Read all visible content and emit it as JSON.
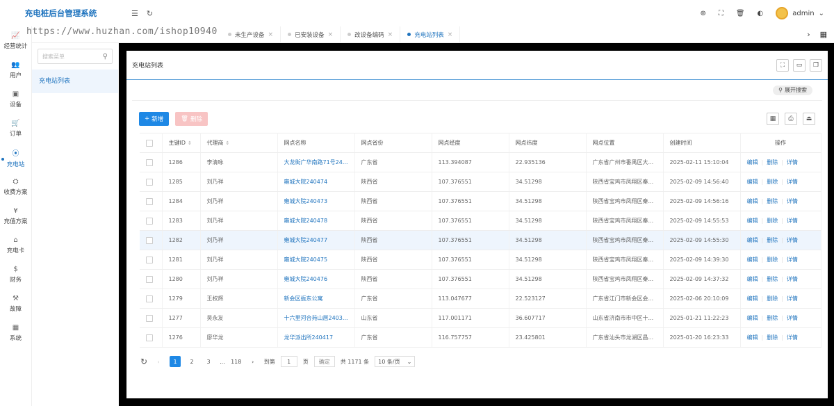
{
  "header": {
    "brand": "充电桩后台管理系统",
    "user": "admin"
  },
  "watermark": "https://www.huzhan.com/ishop10940",
  "tabs": [
    {
      "label": "未生产设备"
    },
    {
      "label": "已安装设备"
    },
    {
      "label": "改设备编码"
    },
    {
      "label": "充电站列表"
    }
  ],
  "nav": [
    {
      "label": "经营统计",
      "icon": "chart-icon"
    },
    {
      "label": "用户",
      "icon": "users-icon"
    },
    {
      "label": "设备",
      "icon": "device-icon"
    },
    {
      "label": "订单",
      "icon": "cart-icon"
    },
    {
      "label": "充电站",
      "icon": "location-icon"
    },
    {
      "label": "收费方案",
      "icon": "plan-icon"
    },
    {
      "label": "充值方案",
      "icon": "yen-icon"
    },
    {
      "label": "充电卡",
      "icon": "tag-icon"
    },
    {
      "label": "财务",
      "icon": "dollar-icon"
    },
    {
      "label": "故障",
      "icon": "wrench-icon"
    },
    {
      "label": "系统",
      "icon": "grid-icon"
    }
  ],
  "submenu": {
    "search_placeholder": "搜索菜单",
    "item": "充电站列表"
  },
  "card": {
    "title": "充电站列表",
    "expand": "展开搜索",
    "add": "新增",
    "delete": "删除"
  },
  "columns": [
    "主键ID",
    "代理商",
    "网点名称",
    "网点省份",
    "网点经度",
    "网点纬度",
    "网点位置",
    "创建时间",
    "操作"
  ],
  "rows": [
    {
      "id": "1286",
      "agent": "李清咏",
      "name": "大龙街广华南路71号24...",
      "province": "广东省",
      "lng": "113.394087",
      "lat": "22.935136",
      "addr": "广东省广州市番禺区大...",
      "time": "2025-02-11 15:10:04"
    },
    {
      "id": "1285",
      "agent": "刘乃祥",
      "name": "雍城大院240474",
      "province": "陕西省",
      "lng": "107.376551",
      "lat": "34.51298",
      "addr": "陕西省宝鸡市凤翔区秦...",
      "time": "2025-02-09 14:56:40"
    },
    {
      "id": "1284",
      "agent": "刘乃祥",
      "name": "雍城大院240473",
      "province": "陕西省",
      "lng": "107.376551",
      "lat": "34.51298",
      "addr": "陕西省宝鸡市凤翔区秦...",
      "time": "2025-02-09 14:56:16"
    },
    {
      "id": "1283",
      "agent": "刘乃祥",
      "name": "雍城大院240478",
      "province": "陕西省",
      "lng": "107.376551",
      "lat": "34.51298",
      "addr": "陕西省宝鸡市凤翔区秦...",
      "time": "2025-02-09 14:55:53"
    },
    {
      "id": "1282",
      "agent": "刘乃祥",
      "name": "雍城大院240477",
      "province": "陕西省",
      "lng": "107.376551",
      "lat": "34.51298",
      "addr": "陕西省宝鸡市凤翔区秦...",
      "time": "2025-02-09 14:55:30"
    },
    {
      "id": "1281",
      "agent": "刘乃祥",
      "name": "雍城大院240475",
      "province": "陕西省",
      "lng": "107.376551",
      "lat": "34.51298",
      "addr": "陕西省宝鸡市凤翔区秦...",
      "time": "2025-02-09 14:39:30"
    },
    {
      "id": "1280",
      "agent": "刘乃祥",
      "name": "雍城大院240476",
      "province": "陕西省",
      "lng": "107.376551",
      "lat": "34.51298",
      "addr": "陕西省宝鸡市凤翔区秦...",
      "time": "2025-02-09 14:37:32"
    },
    {
      "id": "1279",
      "agent": "王权辉",
      "name": "新会区振东公寓",
      "province": "广东省",
      "lng": "113.047677",
      "lat": "22.523127",
      "addr": "广东省江门市新会区会...",
      "time": "2025-02-06 20:10:09"
    },
    {
      "id": "1277",
      "agent": "吴永友",
      "name": "十六里河合苑山居2403...",
      "province": "山东省",
      "lng": "117.001171",
      "lat": "36.607717",
      "addr": "山东省济南市市中区十...",
      "time": "2025-01-21 11:22:23"
    },
    {
      "id": "1276",
      "agent": "廖华龙",
      "name": "龙华派出所240417",
      "province": "广东省",
      "lng": "116.757757",
      "lat": "23.425801",
      "addr": "广东省汕头市龙湖区昌...",
      "time": "2025-01-20 16:23:33"
    }
  ],
  "ops": {
    "edit": "编辑",
    "delete": "删除",
    "detail": "详情"
  },
  "pager": {
    "p1": "1",
    "p2": "2",
    "p3": "3",
    "ellipsis": "...",
    "last": "118",
    "goto": "到第",
    "page_input": "1",
    "page_unit": "页",
    "confirm": "确定",
    "total": "共 1171 条",
    "per_page": "10 条/页"
  }
}
